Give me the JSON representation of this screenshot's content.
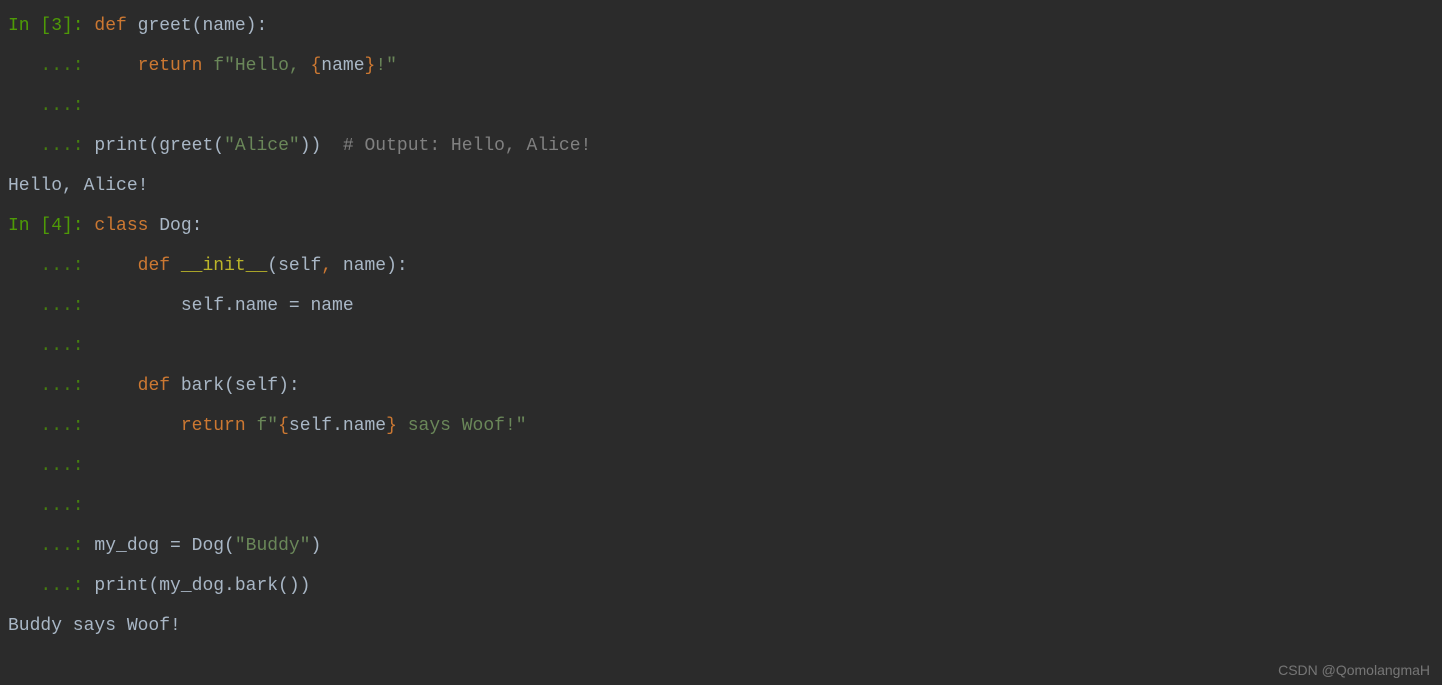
{
  "cells": [
    {
      "prompt": "In [3]:",
      "lines": [
        {
          "cont": false,
          "tokens": [
            {
              "t": "def ",
              "c": "kw"
            },
            {
              "t": "greet",
              "c": "fn2"
            },
            {
              "t": "(name):",
              "c": "paren"
            }
          ]
        },
        {
          "cont": true,
          "tokens": [
            {
              "t": "    ",
              "c": "name"
            },
            {
              "t": "return ",
              "c": "kw"
            },
            {
              "t": "f\"Hello, ",
              "c": "str"
            },
            {
              "t": "{",
              "c": "strbrace"
            },
            {
              "t": "name",
              "c": "finbrace"
            },
            {
              "t": "}",
              "c": "strbrace"
            },
            {
              "t": "!\"",
              "c": "str"
            }
          ]
        },
        {
          "cont": true,
          "tokens": []
        },
        {
          "cont": true,
          "tokens": [
            {
              "t": "print",
              "c": "name"
            },
            {
              "t": "(greet(",
              "c": "paren"
            },
            {
              "t": "\"Alice\"",
              "c": "str"
            },
            {
              "t": "))",
              "c": "paren"
            },
            {
              "t": "  # Output: Hello, Alice!",
              "c": "comment"
            }
          ]
        }
      ],
      "output": "Hello, Alice!"
    },
    {
      "prompt": "In [4]:",
      "lines": [
        {
          "cont": false,
          "tokens": [
            {
              "t": "class ",
              "c": "kw"
            },
            {
              "t": "Dog:",
              "c": "name"
            }
          ]
        },
        {
          "cont": true,
          "tokens": [
            {
              "t": "    ",
              "c": "name"
            },
            {
              "t": "def ",
              "c": "kw"
            },
            {
              "t": "__init__",
              "c": "fn"
            },
            {
              "t": "(self",
              "c": "paren"
            },
            {
              "t": ", ",
              "c": "kw"
            },
            {
              "t": "name):",
              "c": "paren"
            }
          ]
        },
        {
          "cont": true,
          "tokens": [
            {
              "t": "        self.name = name",
              "c": "name"
            }
          ]
        },
        {
          "cont": true,
          "tokens": []
        },
        {
          "cont": true,
          "tokens": [
            {
              "t": "    ",
              "c": "name"
            },
            {
              "t": "def ",
              "c": "kw"
            },
            {
              "t": "bark",
              "c": "fn2"
            },
            {
              "t": "(self):",
              "c": "paren"
            }
          ]
        },
        {
          "cont": true,
          "tokens": [
            {
              "t": "        ",
              "c": "name"
            },
            {
              "t": "return ",
              "c": "kw"
            },
            {
              "t": "f\"",
              "c": "str"
            },
            {
              "t": "{",
              "c": "strbrace"
            },
            {
              "t": "self.name",
              "c": "finbrace"
            },
            {
              "t": "}",
              "c": "strbrace"
            },
            {
              "t": " says Woof!\"",
              "c": "str"
            }
          ]
        },
        {
          "cont": true,
          "tokens": []
        },
        {
          "cont": true,
          "tokens": []
        },
        {
          "cont": true,
          "tokens": [
            {
              "t": "my_dog = Dog(",
              "c": "name"
            },
            {
              "t": "\"Buddy\"",
              "c": "str"
            },
            {
              "t": ")",
              "c": "name"
            }
          ]
        },
        {
          "cont": true,
          "tokens": [
            {
              "t": "print",
              "c": "name"
            },
            {
              "t": "(my_dog.bark())",
              "c": "paren"
            }
          ]
        }
      ],
      "output": "Buddy says Woof!"
    }
  ],
  "continuation_prompt": "   ...:",
  "watermark": "CSDN @QomolangmaH"
}
